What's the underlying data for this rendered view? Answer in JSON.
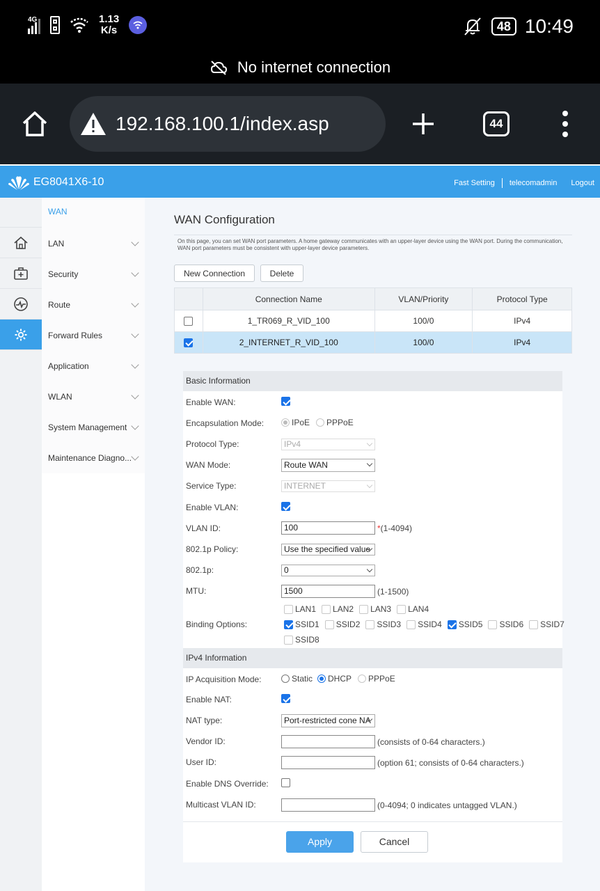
{
  "statusbar": {
    "network": "4G",
    "speed_value": "1.13",
    "speed_unit": "K/s",
    "battery": "48",
    "time": "10:49",
    "notice": "No internet connection"
  },
  "browser": {
    "url": "192.168.100.1/index.asp",
    "tab_count": "44"
  },
  "header": {
    "model": "EG8041X6-10",
    "links": [
      "Fast Setting",
      "telecomadmin",
      "Logout"
    ]
  },
  "menu": {
    "items": [
      "WAN",
      "LAN",
      "Security",
      "Route",
      "Forward Rules",
      "Application",
      "WLAN",
      "System Management",
      "Maintenance Diagno..."
    ]
  },
  "page": {
    "title": "WAN Configuration",
    "description": "On this page, you can set WAN port parameters. A home gateway communicates with an upper-layer device using the WAN port. During the communication, WAN port parameters must be consistent with upper-layer device parameters.",
    "new_connection": "New Connection",
    "delete": "Delete"
  },
  "table": {
    "headers": [
      "Connection Name",
      "VLAN/Priority",
      "Protocol Type"
    ],
    "rows": [
      {
        "name": "1_TR069_R_VID_100",
        "vlan": "100/0",
        "protocol": "IPv4",
        "checked": false
      },
      {
        "name": "2_INTERNET_R_VID_100",
        "vlan": "100/0",
        "protocol": "IPv4",
        "checked": true
      }
    ]
  },
  "basic": {
    "section": "Basic Information",
    "enable_wan": "Enable WAN:",
    "encap_mode": "Encapsulation Mode:",
    "encap_ipoe": "IPoE",
    "encap_pppoe": "PPPoE",
    "protocol_type": "Protocol Type:",
    "protocol_value": "IPv4",
    "wan_mode": "WAN Mode:",
    "wan_mode_value": "Route WAN",
    "service_type": "Service Type:",
    "service_value": "INTERNET",
    "enable_vlan": "Enable VLAN:",
    "vlan_id": "VLAN ID:",
    "vlan_id_value": "100",
    "vlan_req": "*",
    "vlan_hint": "(1-4094)",
    "policy": "802.1p Policy:",
    "policy_value": "Use the specified value",
    "p8021": "802.1p:",
    "p8021_value": "0",
    "mtu": "MTU:",
    "mtu_value": "1500",
    "mtu_hint": "(1-1500)",
    "binding": "Binding Options:",
    "lan_options": [
      "LAN1",
      "LAN2",
      "LAN3",
      "LAN4"
    ],
    "ssid_options": [
      "SSID1",
      "SSID2",
      "SSID3",
      "SSID4",
      "SSID5",
      "SSID6",
      "SSID7"
    ],
    "ssid8": "SSID8"
  },
  "ipv4": {
    "section": "IPv4 Information",
    "ip_mode": "IP Acquisition Mode:",
    "mode_static": "Static",
    "mode_dhcp": "DHCP",
    "mode_pppoe": "PPPoE",
    "enable_nat": "Enable NAT:",
    "nat_type": "NAT type:",
    "nat_type_value": "Port-restricted cone NA",
    "vendor_id": "Vendor ID:",
    "vendor_hint": "(consists of 0-64 characters.)",
    "user_id": "User ID:",
    "user_hint": "(option 61; consists of 0-64 characters.)",
    "dns_override": "Enable DNS Override:",
    "mcast_vlan": "Multicast VLAN ID:",
    "mcast_hint": "(0-4094; 0 indicates untagged VLAN.)"
  },
  "actions": {
    "apply": "Apply",
    "cancel": "Cancel"
  },
  "colors": {
    "accent": "#3aa0e9",
    "selected_row": "#c9e5f8",
    "apply": "#4aa3ea"
  }
}
